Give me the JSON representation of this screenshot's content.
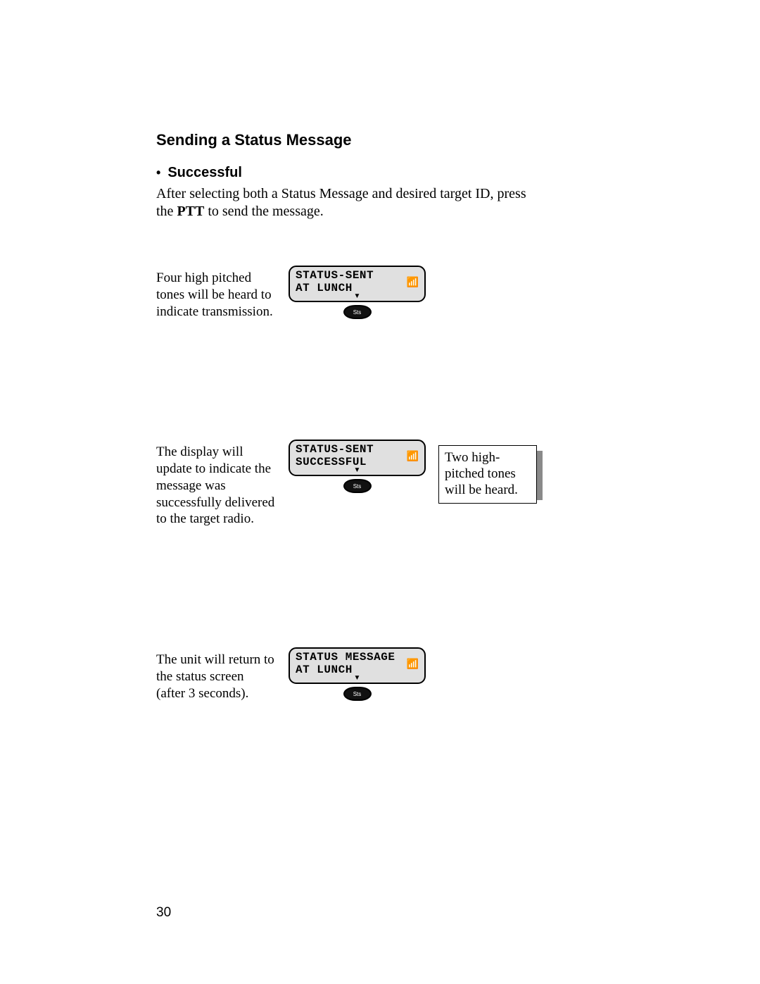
{
  "heading": "Sending a Status Message",
  "bullet_label": "Successful",
  "intro_before": "After selecting both a Status Message and desired target ID, press the ",
  "intro_bold": "PTT",
  "intro_after": " to send the message.",
  "steps": [
    {
      "desc": "Four high pitched tones will be heard to indicate transmission.",
      "lcd_line1": "STATUS-SENT",
      "lcd_line2": "AT LUNCH",
      "note": null
    },
    {
      "desc": "The display will update to indicate the message was successfully delivered to the target radio.",
      "lcd_line1": "STATUS-SENT",
      "lcd_line2": "SUCCESSFUL",
      "note": "Two high-pitched tones will be heard."
    },
    {
      "desc": "The unit will return to the status screen (after 3 seconds).",
      "lcd_line1": "STATUS MESSAGE",
      "lcd_line2": "AT LUNCH",
      "note": null
    }
  ],
  "button_label": "Sts",
  "signal_glyph": "📶",
  "arrow_glyph": "▼",
  "page_number": "30"
}
